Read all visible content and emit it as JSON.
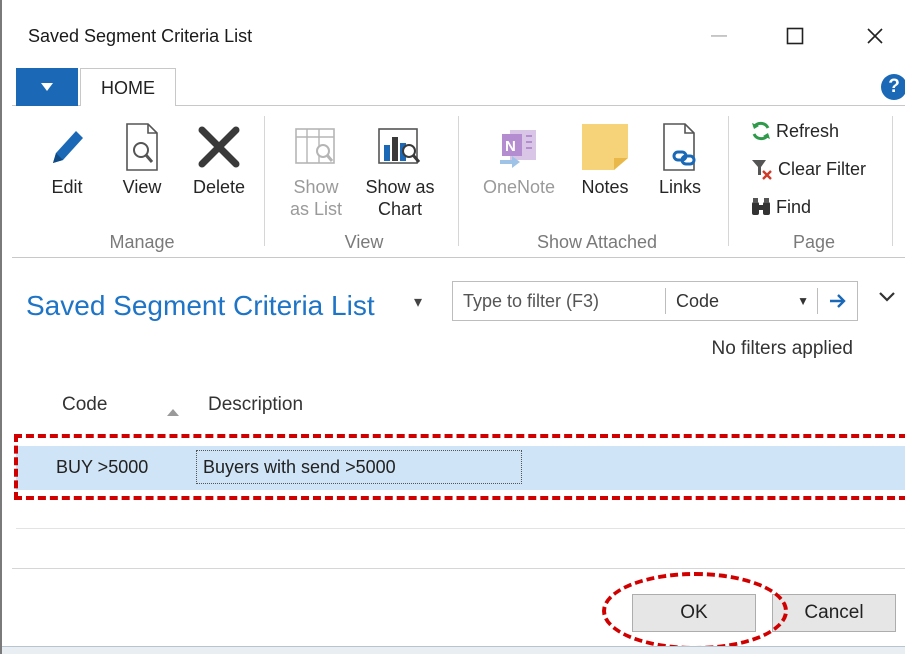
{
  "window": {
    "title": "Saved Segment Criteria List",
    "minimize_glyph": "—",
    "maximize_glyph": "☐",
    "close_glyph": "✕"
  },
  "tabs": {
    "file_icon": "caret-down-icon",
    "home": "HOME",
    "help": "?"
  },
  "ribbon": {
    "manage": {
      "label": "Manage",
      "edit": "Edit",
      "view": "View",
      "delete": "Delete"
    },
    "view_group": {
      "label": "View",
      "show_as_list_1": "Show",
      "show_as_list_2": "as List",
      "show_as_chart_1": "Show as",
      "show_as_chart_2": "Chart"
    },
    "show_attached": {
      "label": "Show Attached",
      "onenote": "OneNote",
      "notes": "Notes",
      "links": "Links"
    },
    "page": {
      "label": "Page",
      "refresh": "Refresh",
      "clear_filter": "Clear Filter",
      "find": "Find"
    }
  },
  "page": {
    "title": "Saved Segment Criteria List",
    "title_caret": "▾"
  },
  "filter": {
    "placeholder": "Type to filter (F3)",
    "field": "Code",
    "field_caret": "▼",
    "status": "No filters applied"
  },
  "grid": {
    "columns": [
      "Code",
      "Description"
    ],
    "rows": [
      {
        "code": "BUY >5000",
        "description": "Buyers with send >5000"
      }
    ]
  },
  "footer": {
    "ok": "OK",
    "cancel": "Cancel"
  },
  "colors": {
    "accent": "#1b69b6",
    "title_blue": "#1e74c6",
    "selected_row": "#cfe4f6",
    "annotation_red": "#d10000"
  }
}
